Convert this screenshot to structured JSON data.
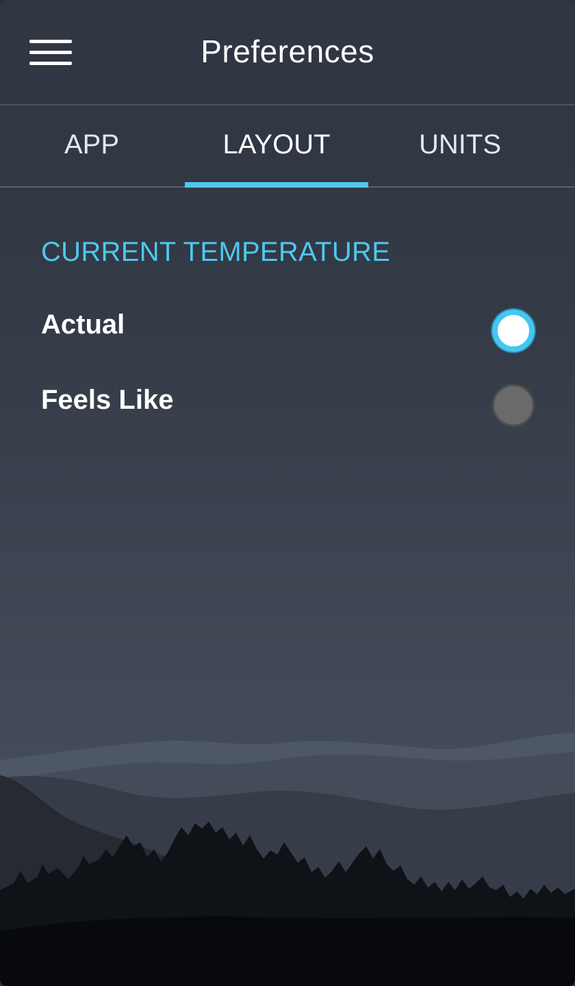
{
  "header": {
    "title": "Preferences",
    "menu_icon": "hamburger-menu-icon"
  },
  "tabs": [
    {
      "label": "APP",
      "selected": false
    },
    {
      "label": "LAYOUT",
      "selected": true
    },
    {
      "label": "UNITS",
      "selected": false
    }
  ],
  "section": {
    "heading": "CURRENT TEMPERATURE",
    "options": [
      {
        "label": "Actual",
        "selected": true
      },
      {
        "label": "Feels Like",
        "selected": false
      }
    ]
  },
  "colors": {
    "accent": "#4fc8ee",
    "background_top": "#2f3641",
    "background_bottom": "#4a5260",
    "radio_unselected": "#6a6a6a"
  }
}
